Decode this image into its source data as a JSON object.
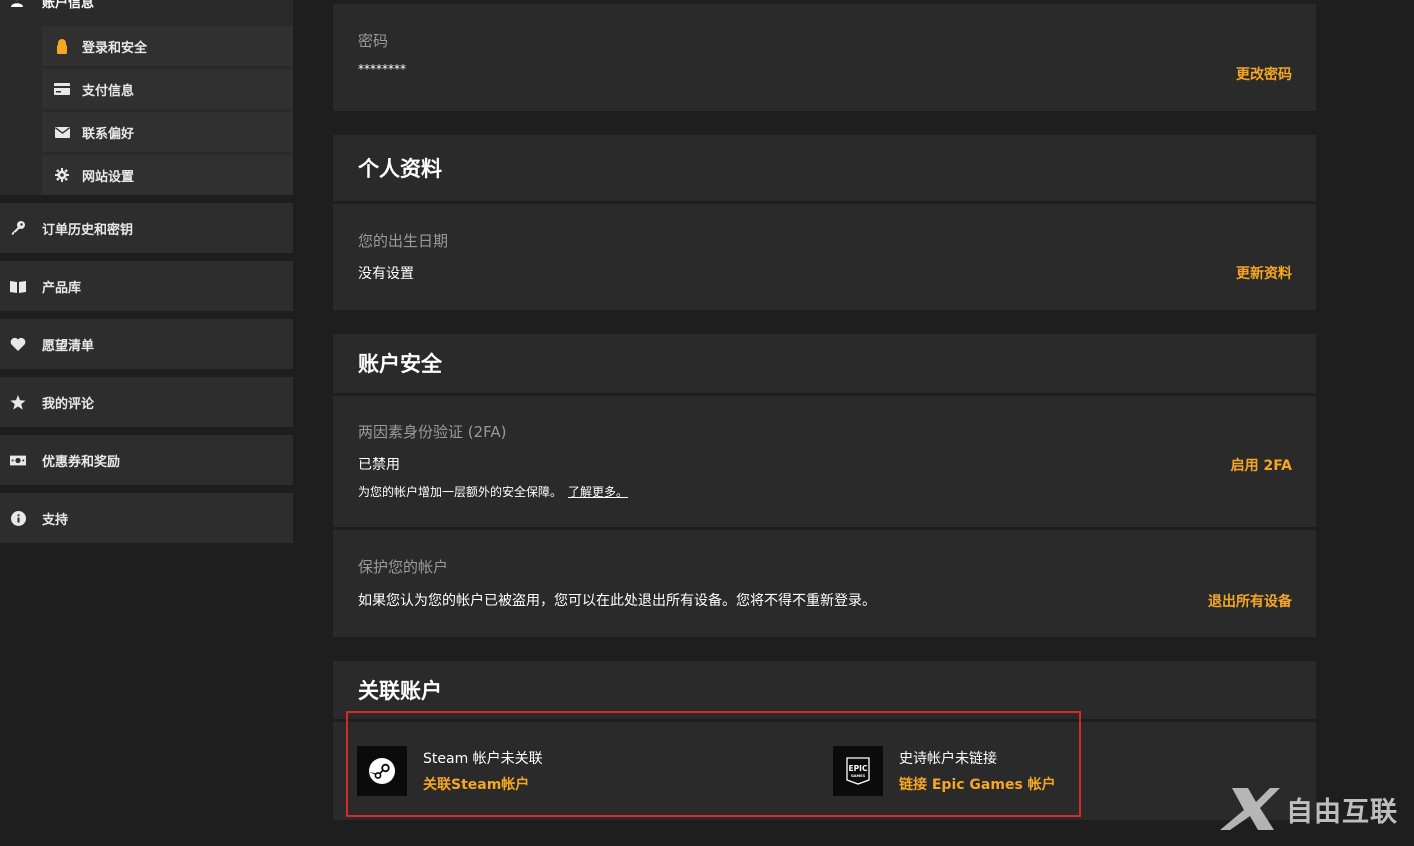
{
  "sidebar": {
    "account_header": "账户信息",
    "sub_items": [
      {
        "label": "登录和安全",
        "icon": "lock-icon",
        "active": true
      },
      {
        "label": "支付信息",
        "icon": "credit-card-icon",
        "active": false
      },
      {
        "label": "联系偏好",
        "icon": "envelope-icon",
        "active": false
      },
      {
        "label": "网站设置",
        "icon": "gear-icon",
        "active": false
      }
    ],
    "items": [
      {
        "label": "订单历史和密钥",
        "icon": "key-icon"
      },
      {
        "label": "产品库",
        "icon": "book-icon"
      },
      {
        "label": "愿望清单",
        "icon": "heart-icon"
      },
      {
        "label": "我的评论",
        "icon": "star-icon"
      },
      {
        "label": "优惠券和奖励",
        "icon": "money-icon"
      },
      {
        "label": "支持",
        "icon": "info-icon"
      }
    ]
  },
  "password": {
    "label": "密码",
    "value": "********",
    "action": "更改密码"
  },
  "profile": {
    "title": "个人资料",
    "birthday_label": "您的出生日期",
    "birthday_value": "没有设置",
    "action": "更新资料"
  },
  "security": {
    "title": "账户安全",
    "twofa_label": "两因素身份验证 (2FA)",
    "twofa_value": "已禁用",
    "twofa_note": "为您的帐户增加一层额外的安全保障。",
    "twofa_learn_more": "了解更多。",
    "twofa_action": "启用 2FA",
    "protect_label": "保护您的帐户",
    "protect_value": "如果您认为您的帐户已被盗用，您可以在此处退出所有设备。您将不得不重新登录。",
    "protect_action": "退出所有设备"
  },
  "linked": {
    "title": "关联账户",
    "steam_status": "Steam 帐户未关联",
    "steam_action": "关联Steam帐户",
    "epic_status": "史诗帐户未链接",
    "epic_action": "链接 Epic Games 帐户",
    "epic_logo_top": "EPIC",
    "epic_logo_bottom": "GAMES"
  },
  "watermark": {
    "text": "自由互联"
  },
  "colors": {
    "accent": "#f5a623",
    "background": "#1e1e1e",
    "card": "#2a2a2a",
    "highlight_border": "#d42a2a"
  }
}
